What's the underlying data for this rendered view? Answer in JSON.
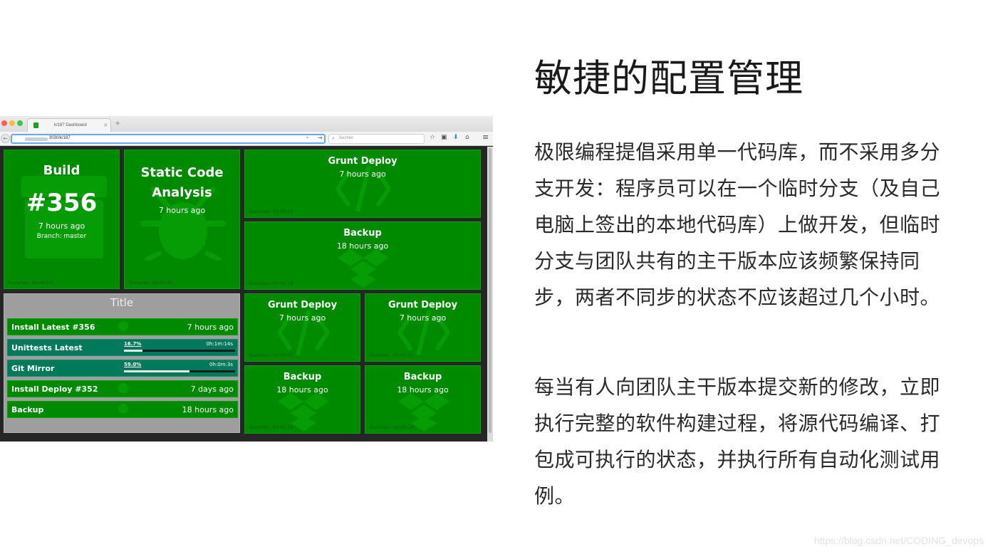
{
  "browser": {
    "tab_title": "k/187 Dashboard",
    "url": "3030/k/187",
    "search_placeholder": "Suchen",
    "icons": {
      "back": "back-arrow-icon",
      "newtab": "plus-icon",
      "close": "close-icon",
      "go": "arrow-go-icon",
      "search": "search-icon",
      "bookmark": "star-icon",
      "reader": "clipboard-icon",
      "download": "download-icon",
      "home": "home-icon",
      "menu": "hamburger-menu-icon"
    },
    "glyphs": {
      "back": "←",
      "newtab": "+",
      "close": "×",
      "go": "→",
      "dropdown": "▾",
      "search": "⌕",
      "bookmark": "☆",
      "reader": "▣",
      "download": "⬇",
      "home": "⌂",
      "menu": "≡"
    }
  },
  "dashboard": {
    "colors": {
      "success": "#008a00",
      "running": "#007a5a",
      "group_bg": "#9e9e9e",
      "background": "#262626"
    },
    "build": {
      "title": "Build",
      "number": "#356",
      "time": "7 hours ago",
      "branch": "Branch: master",
      "duration": "Duration: 00:04:57"
    },
    "static_analysis": {
      "title": "Static Code Analysis",
      "time": "7 hours ago",
      "duration": "Duration: 00:01:43"
    },
    "top_right": [
      {
        "title": "Grunt Deploy",
        "time": "7 hours ago",
        "duration": "Duration: 00:03:22",
        "icon": "code-icon"
      },
      {
        "title": "Backup",
        "time": "18 hours ago",
        "duration": "Duration: 00:00:18",
        "icon": "dropbox-icon"
      }
    ],
    "grid": [
      {
        "title": "Grunt Deploy",
        "time": "7 hours ago",
        "duration": "Duration: 00:03:22",
        "icon": "code-icon"
      },
      {
        "title": "Grunt Deploy",
        "time": "7 hours ago",
        "duration": "Duration: 00:03:22",
        "icon": "code-icon"
      },
      {
        "title": "Backup",
        "time": "18 hours ago",
        "duration": "Duration: 00:00:18",
        "icon": "dropbox-icon"
      },
      {
        "title": "Backup",
        "time": "18 hours ago",
        "duration": "Duration: 00:00:18",
        "icon": "dropbox-icon"
      }
    ],
    "group": {
      "title": "Title",
      "rows": [
        {
          "name": "Install Latest  #356",
          "status": "success",
          "time": "7 hours ago"
        },
        {
          "name": "Unittests Latest",
          "status": "running",
          "percent_label": "16.7%",
          "progress": 0.167,
          "eta": "0h:1m:14s"
        },
        {
          "name": "Git Mirror",
          "status": "running",
          "percent_label": "59.0%",
          "progress": 0.59,
          "eta": "0h:0m:3s"
        },
        {
          "name": "Install Deploy  #352",
          "status": "success",
          "time": "7 days ago"
        },
        {
          "name": "Backup",
          "status": "success",
          "time": "18 hours ago"
        }
      ]
    }
  },
  "article": {
    "heading": "敏捷的配置管理",
    "paragraph1": "极限编程提倡采用单一代码库，而不采用多分支开发：程序员可以在一个临时分支（及自己电脑上签出的本地代码库）上做开发，但临时分支与团队共有的主干版本应该频繁保持同步，两者不同步的状态不应该超过几个小时。",
    "paragraph2": "每当有人向团队主干版本提交新的修改，立即执行完整的软件构建过程，将源代码编译、打包成可执行的状态，并执行所有自动化测试用例。"
  },
  "watermark": "https://blog.csdn.net/CODING_devops"
}
